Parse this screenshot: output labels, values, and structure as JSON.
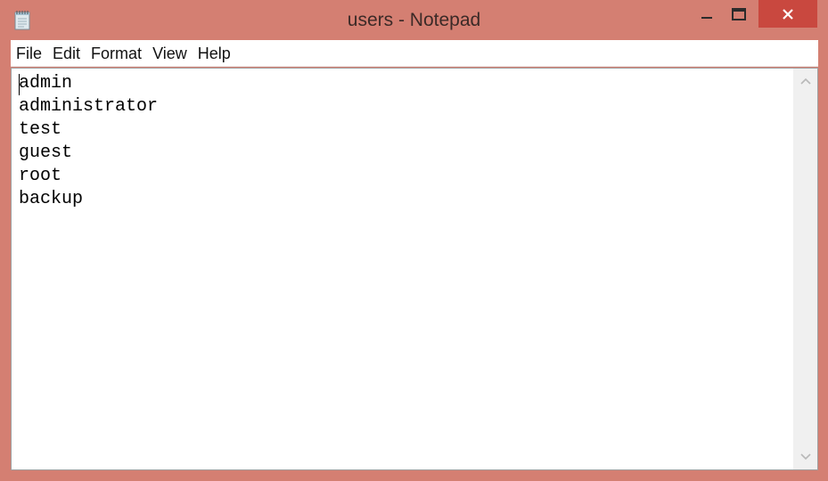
{
  "window": {
    "title": "users - Notepad",
    "accent_color": "#d47f72",
    "close_color": "#c9483f"
  },
  "icons": {
    "app": "notepad-icon",
    "minimize": "minimize-icon",
    "maximize": "maximize-icon",
    "close": "close-icon",
    "scroll_up": "chevron-up-icon",
    "scroll_down": "chevron-down-icon"
  },
  "menu": {
    "items": [
      {
        "label": "File"
      },
      {
        "label": "Edit"
      },
      {
        "label": "Format"
      },
      {
        "label": "View"
      },
      {
        "label": "Help"
      }
    ]
  },
  "document": {
    "lines": [
      "admin",
      "administrator",
      "test",
      "guest",
      "root",
      "backup"
    ]
  }
}
